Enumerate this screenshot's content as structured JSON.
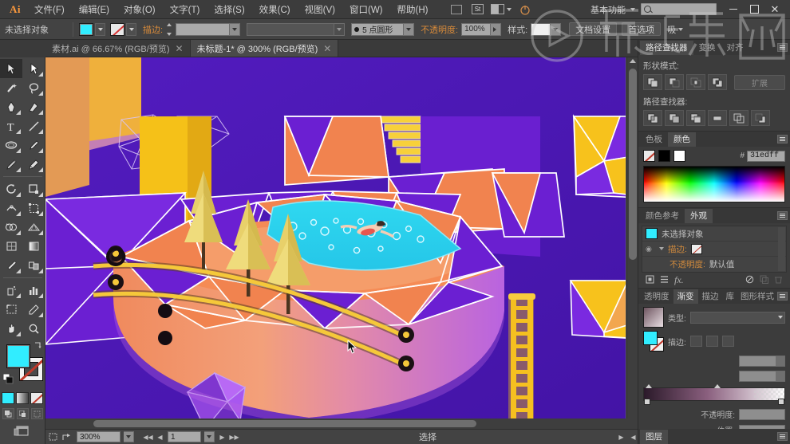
{
  "app": {
    "name": "Ai",
    "title": "Adobe Illustrator"
  },
  "menubar": {
    "items": [
      {
        "label": "文件(F)",
        "name": "menu-file"
      },
      {
        "label": "编辑(E)",
        "name": "menu-edit"
      },
      {
        "label": "对象(O)",
        "name": "menu-object"
      },
      {
        "label": "文字(T)",
        "name": "menu-type"
      },
      {
        "label": "选择(S)",
        "name": "menu-select"
      },
      {
        "label": "效果(C)",
        "name": "menu-effect"
      },
      {
        "label": "视图(V)",
        "name": "menu-view"
      },
      {
        "label": "窗口(W)",
        "name": "menu-window"
      },
      {
        "label": "帮助(H)",
        "name": "menu-help"
      }
    ],
    "bridge_icon": "bridge-icon",
    "stock_icon": "stock-icon",
    "arrange_icon": "arrange-documents-icon",
    "workspace": "基本功能",
    "search_placeholder": "",
    "search_value": "",
    "minimize": "−",
    "maximize": "▢",
    "close": "✕"
  },
  "controlbar": {
    "selection_status": "未选择对象",
    "fill_color": "#31edff",
    "stroke_color": "#ffffff",
    "stroke_label": "描边:",
    "stroke_weight": "",
    "stroke_profile": "",
    "brush_label": "5 点圆形",
    "opacity_label": "不透明度:",
    "opacity_value": "100%",
    "style_label": "样式:",
    "doc_setup": "文档设置",
    "preferences": "首选项",
    "more_label": "吸"
  },
  "tabs": [
    {
      "label": "素材.ai @ 66.67% (RGB/预览)",
      "active": false,
      "close": "✕"
    },
    {
      "label": "未标题-1* @ 300% (RGB/预览)",
      "active": true,
      "close": "✕"
    }
  ],
  "toolbar": {
    "tools": [
      {
        "name": "selection-tool",
        "selected": true
      },
      {
        "name": "direct-selection-tool",
        "selected": false
      },
      {
        "name": "magic-wand-tool",
        "selected": false
      },
      {
        "name": "lasso-tool",
        "selected": false
      },
      {
        "name": "pen-tool",
        "selected": false
      },
      {
        "name": "curvature-tool",
        "selected": false
      },
      {
        "name": "type-tool",
        "selected": false
      },
      {
        "name": "line-segment-tool",
        "selected": false
      },
      {
        "name": "ellipse-tool",
        "selected": false
      },
      {
        "name": "paintbrush-tool",
        "selected": false
      },
      {
        "name": "shaper-tool",
        "selected": false
      },
      {
        "name": "pencil-tool",
        "selected": false
      },
      {
        "name": "rotate-tool",
        "selected": false
      },
      {
        "name": "scale-tool",
        "selected": false
      },
      {
        "name": "width-tool",
        "selected": false
      },
      {
        "name": "free-transform-tool",
        "selected": false
      },
      {
        "name": "shape-builder-tool",
        "selected": false
      },
      {
        "name": "perspective-grid-tool",
        "selected": false
      },
      {
        "name": "mesh-tool",
        "selected": false
      },
      {
        "name": "gradient-tool",
        "selected": false
      },
      {
        "name": "eyedropper-tool",
        "selected": false
      },
      {
        "name": "blend-tool",
        "selected": false
      },
      {
        "name": "symbol-sprayer-tool",
        "selected": false
      },
      {
        "name": "column-graph-tool",
        "selected": false
      },
      {
        "name": "artboard-tool",
        "selected": false
      },
      {
        "name": "slice-tool",
        "selected": false
      },
      {
        "name": "hand-tool",
        "selected": false
      },
      {
        "name": "zoom-tool",
        "selected": false
      }
    ],
    "fill_color": "#31edff",
    "stroke_color": "none",
    "modes": [
      "color-mode",
      "gradient-mode",
      "none-mode"
    ],
    "draw_modes": [
      "draw-normal",
      "draw-behind",
      "draw-inside"
    ],
    "screen_mode": "screen-mode-icon"
  },
  "panels": {
    "pathfinder": {
      "tabs": [
        "路径查找器",
        "变换",
        "对齐"
      ],
      "active_tab": "路径查找器",
      "shape_modes_label": "形状模式:",
      "shape_mode_buttons": [
        "unite",
        "minus-front",
        "intersect",
        "exclude"
      ],
      "expand_button": "扩展",
      "pathfinders_label": "路径查找器:",
      "pathfinder_buttons": [
        "divide",
        "trim",
        "merge",
        "crop",
        "outline",
        "minus-back"
      ]
    },
    "color": {
      "tabs": [
        "色板",
        "颜色"
      ],
      "active_tab": "颜色",
      "swatches": [
        "none",
        "black",
        "white"
      ],
      "hex_prefix": "#",
      "hex_value": "31edff"
    },
    "appearance": {
      "tabs": [
        "颜色参考",
        "外观"
      ],
      "active_tab": "外观",
      "target_label": "未选择对象",
      "rows": [
        {
          "label": "描边:",
          "name": "appearance-stroke-row"
        },
        {
          "label": "不透明度:",
          "value": "默认值",
          "name": "appearance-opacity-row"
        }
      ],
      "footer_icons": [
        "add-new-stroke",
        "add-new-fill",
        "add-new-effect",
        "clear-appearance",
        "duplicate-item",
        "delete-item"
      ]
    },
    "gradient": {
      "tabs": [
        "透明度",
        "渐变",
        "描边",
        "库",
        "图形样式"
      ],
      "active_tab": "渐变",
      "type_label": "类型:",
      "type_value": "",
      "stroke_label": "描边:",
      "angle_label": "",
      "ratio_label": "",
      "opacity_label": "不透明度:",
      "opacity_value": "",
      "position_label": "位置:",
      "position_value": ""
    },
    "layers": {
      "tabs": [
        "图层"
      ],
      "active_tab": "图层"
    }
  },
  "statusbar": {
    "zoom": "300%",
    "artboard_number": "1",
    "status_text": "选择"
  },
  "canvas": {
    "artwork_name": "低多边形等距泳池插画",
    "background_color": "#4a18b5",
    "platform_color": "#f3804e",
    "pool_color": "#2fd8f0",
    "tree_color": "#e8d06a",
    "ladder_color": "#f5c020",
    "cursor": "arrow-cursor"
  },
  "watermark": {
    "text": "虎课网",
    "logo": "play-button-logo"
  }
}
